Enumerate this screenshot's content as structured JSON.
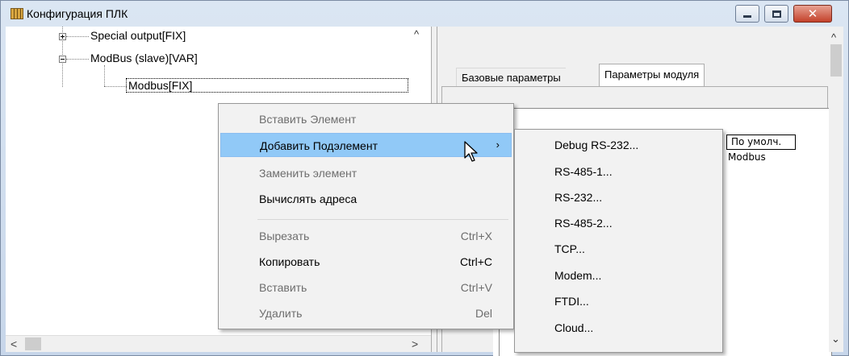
{
  "window": {
    "title": "Конфигурация ПЛК"
  },
  "tree": {
    "items": [
      {
        "label": "Special output[FIX]",
        "expander": "plus"
      },
      {
        "label": "ModBus (slave)[VAR]",
        "expander": "minus"
      },
      {
        "label": "Modbus[FIX]",
        "selected": true
      }
    ]
  },
  "tabs": [
    {
      "label": "Базовые параметры",
      "active": false
    },
    {
      "label": "Параметры модуля",
      "active": true
    }
  ],
  "table": {
    "header": "По умолч.",
    "values": [
      "Modbus"
    ]
  },
  "context_menu": {
    "items": [
      {
        "label": "Вставить Элемент",
        "enabled": false
      },
      {
        "label": "Добавить Подэлемент",
        "enabled": true,
        "highlighted": true,
        "submenu": true
      },
      {
        "label": "Заменить элемент",
        "enabled": false
      },
      {
        "label": "Вычислять адреса",
        "enabled": true
      },
      {
        "label": "Вырезать",
        "shortcut": "Ctrl+X",
        "enabled": false
      },
      {
        "label": "Копировать",
        "shortcut": "Ctrl+C",
        "enabled": true
      },
      {
        "label": "Вставить",
        "shortcut": "Ctrl+V",
        "enabled": false
      },
      {
        "label": "Удалить",
        "shortcut": "Del",
        "enabled": false
      }
    ]
  },
  "submenu": {
    "items": [
      {
        "label": "Debug RS-232..."
      },
      {
        "label": "RS-485-1..."
      },
      {
        "label": "RS-232..."
      },
      {
        "label": "RS-485-2..."
      },
      {
        "label": "TCP..."
      },
      {
        "label": "Modem..."
      },
      {
        "label": "FTDI..."
      },
      {
        "label": "Cloud..."
      }
    ]
  },
  "icons": {
    "submenu_arrow": "›",
    "close": "✕",
    "scroll_up": "^",
    "scroll_down": "⌄",
    "scroll_left": "<",
    "scroll_right": ">"
  },
  "colors": {
    "menu_highlight": "#91c9f7",
    "close_button": "#c3412a"
  }
}
